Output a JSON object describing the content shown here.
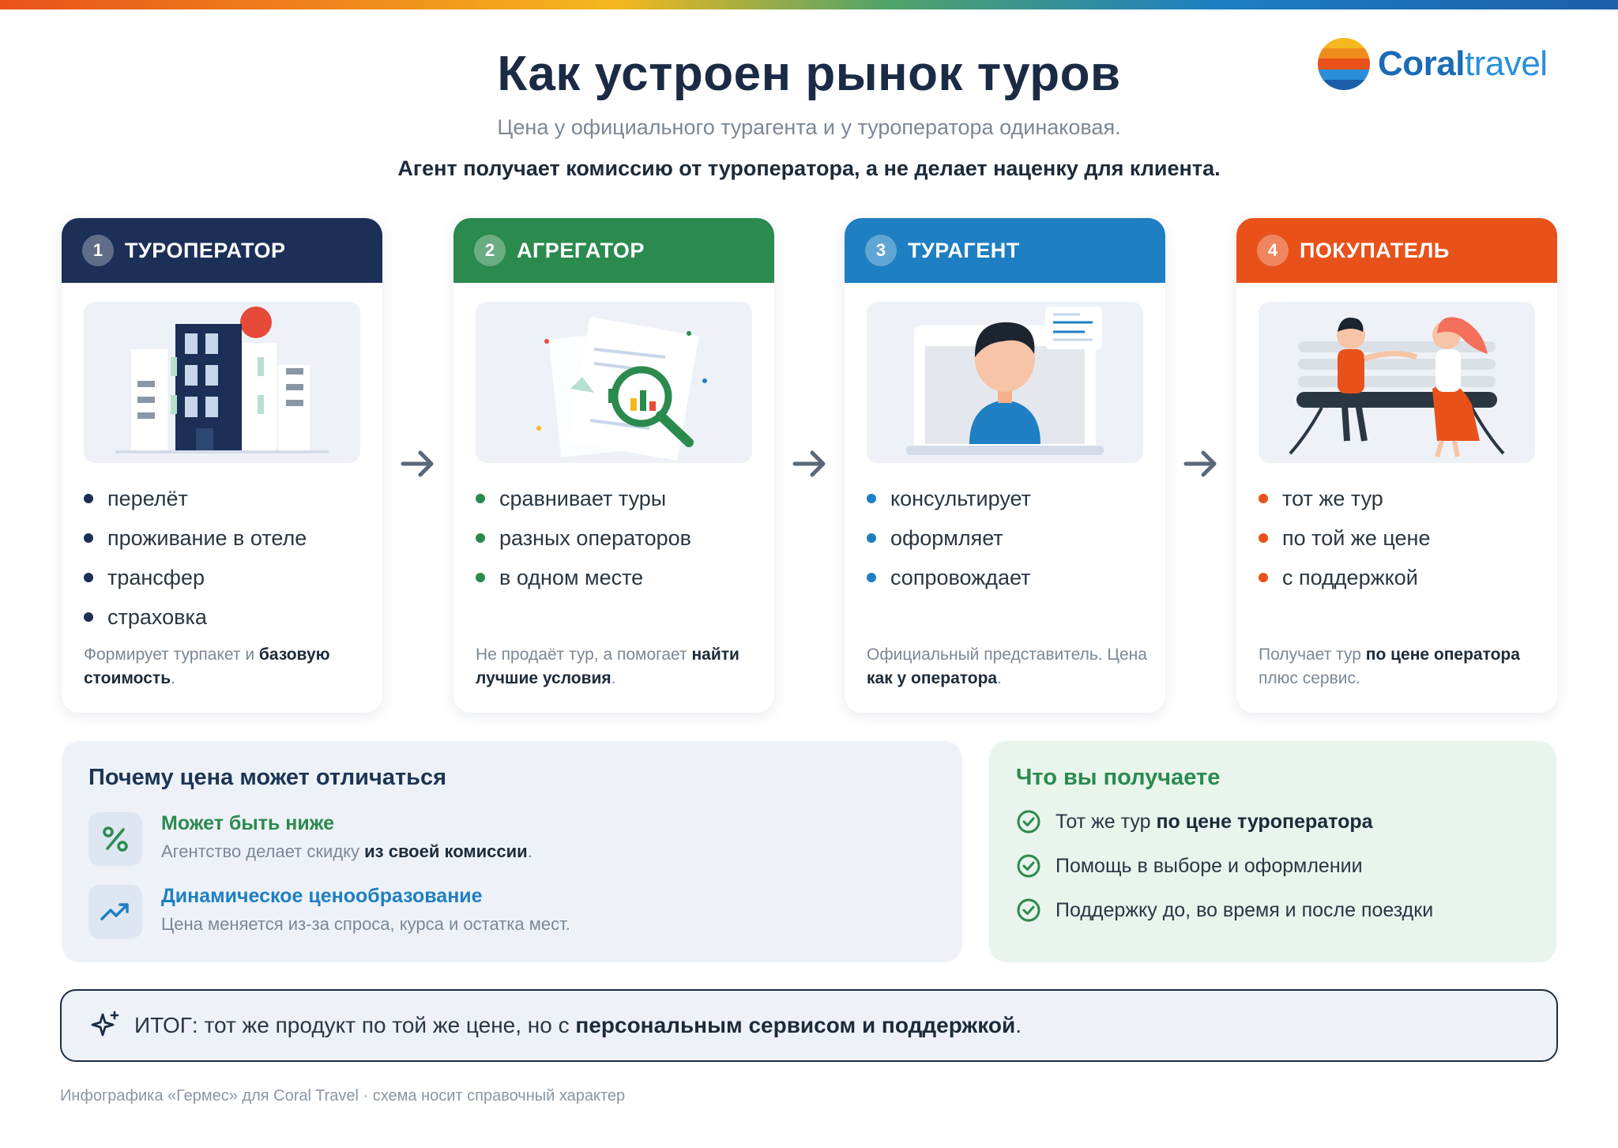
{
  "brand": {
    "logo_part1": "Coral",
    "logo_part2": "travel",
    "logo_stripes": [
      "#f5b81e",
      "#f08a1c",
      "#e8521a",
      "#2a8fd8",
      "#1b5fa8"
    ]
  },
  "header": {
    "title": "Как устроен рынок туров",
    "subtitle": "Цена у официального турагента и у туроператора одинаковая.",
    "subtitle2": "Агент получает комиссию от туроператора, а не делает наценку для клиента."
  },
  "cards": [
    {
      "num": "1",
      "title": "ТУРОПЕРАТОР",
      "color": "#1b2f57",
      "dot": "#1b2f57",
      "items": [
        "перелёт",
        "проживание в отеле",
        "трансфер",
        "страховка"
      ],
      "note_a": "Формирует турпакет и ",
      "note_b": "базовую стоимость",
      "note_c": "."
    },
    {
      "num": "2",
      "title": "АГРЕГАТОР",
      "color": "#2b8a4e",
      "dot": "#2b8a4e",
      "items": [
        "сравнивает туры",
        "разных операторов",
        "в одном месте"
      ],
      "note_a": "Не продаёт тур, а помогает ",
      "note_b": "найти лучшие условия",
      "note_c": "."
    },
    {
      "num": "3",
      "title": "ТУРАГЕНТ",
      "color": "#1e7fc2",
      "dot": "#1e7fc2",
      "items": [
        "консультирует",
        "оформляет",
        "сопровождает"
      ],
      "note_a": "Официальный представитель. Цена ",
      "note_b": "как у оператора",
      "note_c": "."
    },
    {
      "num": "4",
      "title": "ПОКУПАТЕЛЬ",
      "color": "#e8521a",
      "dot": "#e8521a",
      "items": [
        "тот же тур",
        "по той же цене",
        "с поддержкой"
      ],
      "note_a": "Получает тур ",
      "note_b": "по цене оператора",
      "note_c": " плюс сервис."
    }
  ],
  "why": {
    "title": "Почему цена может отличаться",
    "row1": {
      "head": "Может быть ниже",
      "sub_a": "Агентство делает скидку ",
      "sub_b": "из своей комиссии",
      "sub_c": ".",
      "color": "#2b8a4e",
      "icon": "percent-icon"
    },
    "row2": {
      "head": "Динамическое ценообразование",
      "sub": "Цена меняется из-за спроса, курса и остатка мест.",
      "color": "#1e7fc2",
      "icon": "trend-up-icon"
    }
  },
  "get": {
    "title": "Что вы получаете",
    "items": [
      {
        "a": "Тот же тур ",
        "b": "по цене туроператора"
      },
      {
        "a": "Помощь в выборе и оформлении",
        "b": ""
      },
      {
        "a": "Поддержку до, во время и после поездки",
        "b": ""
      }
    ]
  },
  "total": {
    "a": "ИТОГ: тот же продукт по той же цене, но с ",
    "b": "персональным сервисом и поддержкой",
    "c": "."
  },
  "footer": "Инфографика «Гермес» для Coral Travel · схема носит справочный характер"
}
